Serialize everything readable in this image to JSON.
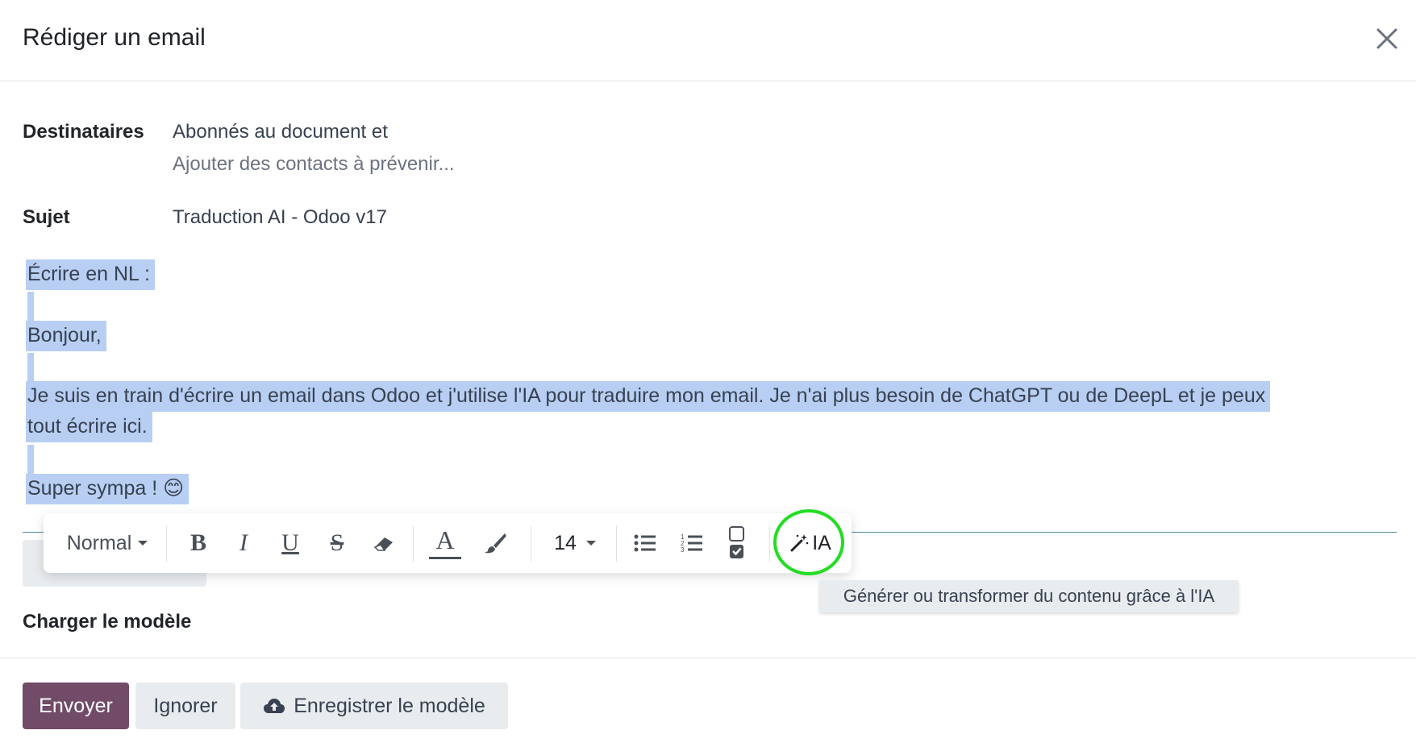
{
  "dialog": {
    "title": "Rédiger un email"
  },
  "form": {
    "recipients_label": "Destinataires",
    "recipients_value": "Abonnés au document et",
    "recipients_placeholder": "Ajouter des contacts à prévenir...",
    "subject_label": "Sujet",
    "subject_value": "Traduction AI - Odoo v17"
  },
  "body": {
    "line1": "Écrire en NL :",
    "line2": "Bonjour,",
    "line3a": "Je suis en train d'écrire un email dans Odoo et j'utilise l'IA pour traduire mon email. Je n'ai plus besoin de ChatGPT ou de DeepL et je peux",
    "line3b": "tout écrire ici.",
    "line4": "Super sympa ! 😊"
  },
  "toolbar": {
    "style_label": "Normal",
    "font_size": "14",
    "ia_label": "IA",
    "ia_tooltip": "Générer ou transformer du contenu grâce à l'IA"
  },
  "template": {
    "load_label": "Charger le modèle"
  },
  "footer": {
    "send_label": "Envoyer",
    "discard_label": "Ignorer",
    "save_template_label": "Enregistrer le modèle"
  },
  "colors": {
    "primary": "#714b67",
    "selection": "#b8cff3",
    "highlight_ring": "#22dd22"
  }
}
